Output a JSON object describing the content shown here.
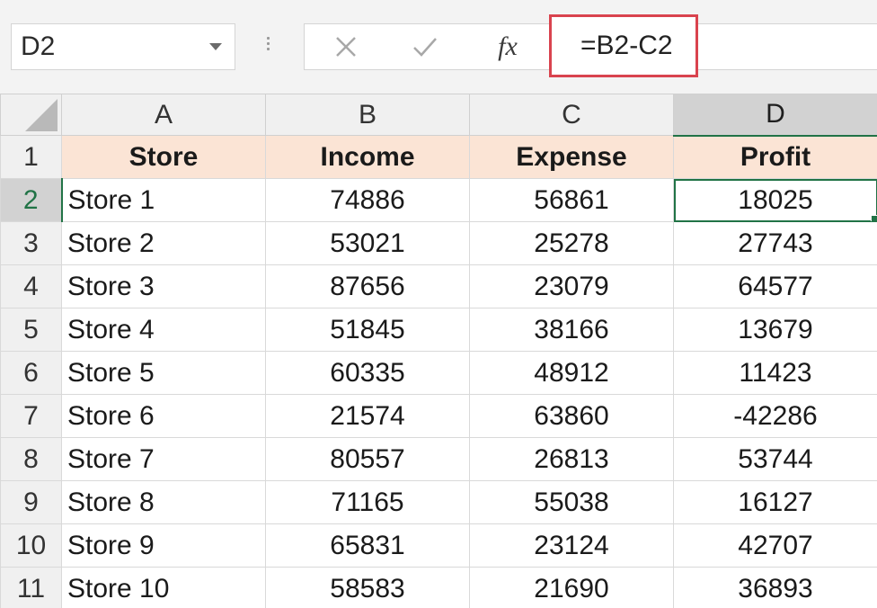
{
  "name_box": {
    "value": "D2"
  },
  "formula_bar": {
    "cancel_icon": "x-icon",
    "enter_icon": "check-icon",
    "insert_function_label": "fx",
    "formula": "=B2-C2"
  },
  "columns": [
    "A",
    "B",
    "C",
    "D"
  ],
  "selected_column": "D",
  "selected_row": "2",
  "header": {
    "row": "1",
    "cells": [
      "Store",
      "Income",
      "Expense",
      "Profit"
    ]
  },
  "rows": [
    {
      "row": "2",
      "store": "Store 1",
      "income": "74886",
      "expense": "56861",
      "profit": "18025"
    },
    {
      "row": "3",
      "store": "Store 2",
      "income": "53021",
      "expense": "25278",
      "profit": "27743"
    },
    {
      "row": "4",
      "store": "Store 3",
      "income": "87656",
      "expense": "23079",
      "profit": "64577"
    },
    {
      "row": "5",
      "store": "Store 4",
      "income": "51845",
      "expense": "38166",
      "profit": "13679"
    },
    {
      "row": "6",
      "store": "Store 5",
      "income": "60335",
      "expense": "48912",
      "profit": "11423"
    },
    {
      "row": "7",
      "store": "Store 6",
      "income": "21574",
      "expense": "63860",
      "profit": "-42286"
    },
    {
      "row": "8",
      "store": "Store 7",
      "income": "80557",
      "expense": "26813",
      "profit": "53744"
    },
    {
      "row": "9",
      "store": "Store 8",
      "income": "71165",
      "expense": "55038",
      "profit": "16127"
    },
    {
      "row": "10",
      "store": "Store 9",
      "income": "65831",
      "expense": "23124",
      "profit": "42707"
    },
    {
      "row": "11",
      "store": "Store 10",
      "income": "58583",
      "expense": "21690",
      "profit": "36893"
    }
  ],
  "colors": {
    "accent": "#217346",
    "header_fill": "#fbe4d5",
    "formula_highlight": "#d9434e"
  }
}
